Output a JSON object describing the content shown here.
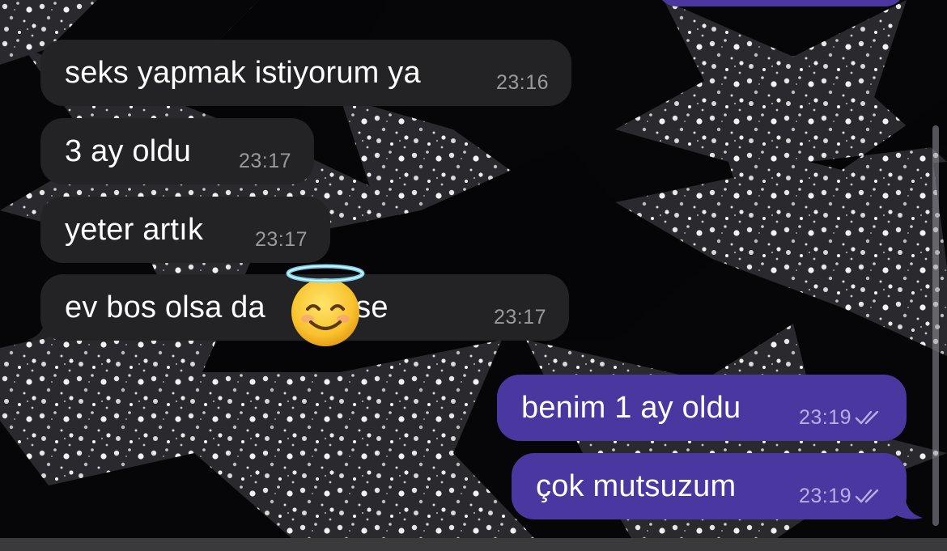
{
  "chat": {
    "incoming_color": "#232325",
    "outgoing_color": "#4a37a0",
    "messages": [
      {
        "text": "seks yapmak istiyorum ya",
        "time": "23:16",
        "direction": "incoming"
      },
      {
        "text": "3 ay oldu",
        "time": "23:17",
        "direction": "incoming"
      },
      {
        "text": "yeter artık",
        "time": "23:17",
        "direction": "incoming"
      },
      {
        "text": "ev bos olsa da",
        "text_after": "gelse",
        "time": "23:17",
        "direction": "incoming",
        "emoji": "smiling-face-with-halo-icon"
      },
      {
        "text": "benim 1 ay oldu",
        "time": "23:19",
        "direction": "outgoing",
        "status": "read-double-check-icon"
      },
      {
        "text": "çok mutsuzum",
        "time": "23:19",
        "direction": "outgoing",
        "status": "read-double-check-icon"
      }
    ]
  }
}
